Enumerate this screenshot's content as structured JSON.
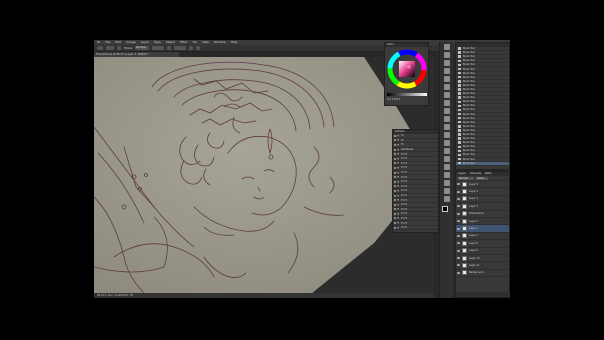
{
  "menu": [
    "Ps",
    "File",
    "Edit",
    "Image",
    "Layer",
    "Type",
    "Select",
    "Filter",
    "3D",
    "View",
    "Window",
    "Help"
  ],
  "options_bar": {
    "label": "Mode:",
    "mode": "Normal"
  },
  "document_tab": "FinishedLine at 66.7% (Layer 3, RGB/8) *",
  "status_bar": "66.67%   Doc: 24.9M/361.7M",
  "color_panel": {
    "title": "Color",
    "footer": "H 0  S 0  B 0"
  },
  "actions_panel": {
    "title": "Actions",
    "items": [
      "Fx",
      "Fx",
      "Fx",
      "Add Bevel",
      "Fx Fx",
      "Fx Fx",
      "Fx Fx",
      "Fx Fx",
      "Fx Fx",
      "Fx Fx",
      "Fx Fx",
      "Fx Fx",
      "Fx Fx",
      "Fx Fx",
      "Fx Fx",
      "Fx Fx",
      "Fx Fx",
      "Fx Fx",
      "Fx Fx",
      "Fx Fx",
      "Fx Fx"
    ]
  },
  "history_panel": {
    "items": [
      "Brush Tool",
      "Brush Tool",
      "Brush Tool",
      "Brush Tool",
      "Brush Tool",
      "Brush Tool",
      "Brush Tool",
      "Brush Tool",
      "Brush Tool",
      "Brush Tool",
      "Brush Tool",
      "Brush Tool",
      "Brush Tool",
      "Brush Tool",
      "Brush Tool",
      "Brush Tool",
      "Brush Tool",
      "Brush Tool",
      "Brush Tool",
      "Brush Tool",
      "Brush Tool",
      "Brush Tool",
      "Brush Tool",
      "Brush Tool",
      "Brush Tool",
      "Brush Tool",
      "Brush Tool",
      "Brush Tool",
      "Brush Tool"
    ],
    "selected_index": 28
  },
  "layers_panel": {
    "tabs": [
      "Layers",
      "Channels",
      "Paths"
    ],
    "blend_mode": "Normal",
    "opacity": "100%",
    "layers": [
      "Layer 6",
      "Layer 5",
      "Layer 4",
      "Layer 3",
      "FinishedLine",
      "Layer 2",
      "Layer 1",
      "Layer 7",
      "Layer 8",
      "Layer 9",
      "Layer 10",
      "Layer 11",
      "Background"
    ],
    "selected_index": 6
  },
  "colors": {
    "ui_bg": "#282828",
    "panel_bg": "#383838",
    "canvas_paper": "#9e9b8f",
    "line_art": "#5e3a44",
    "selection": "#4a5f7a"
  }
}
